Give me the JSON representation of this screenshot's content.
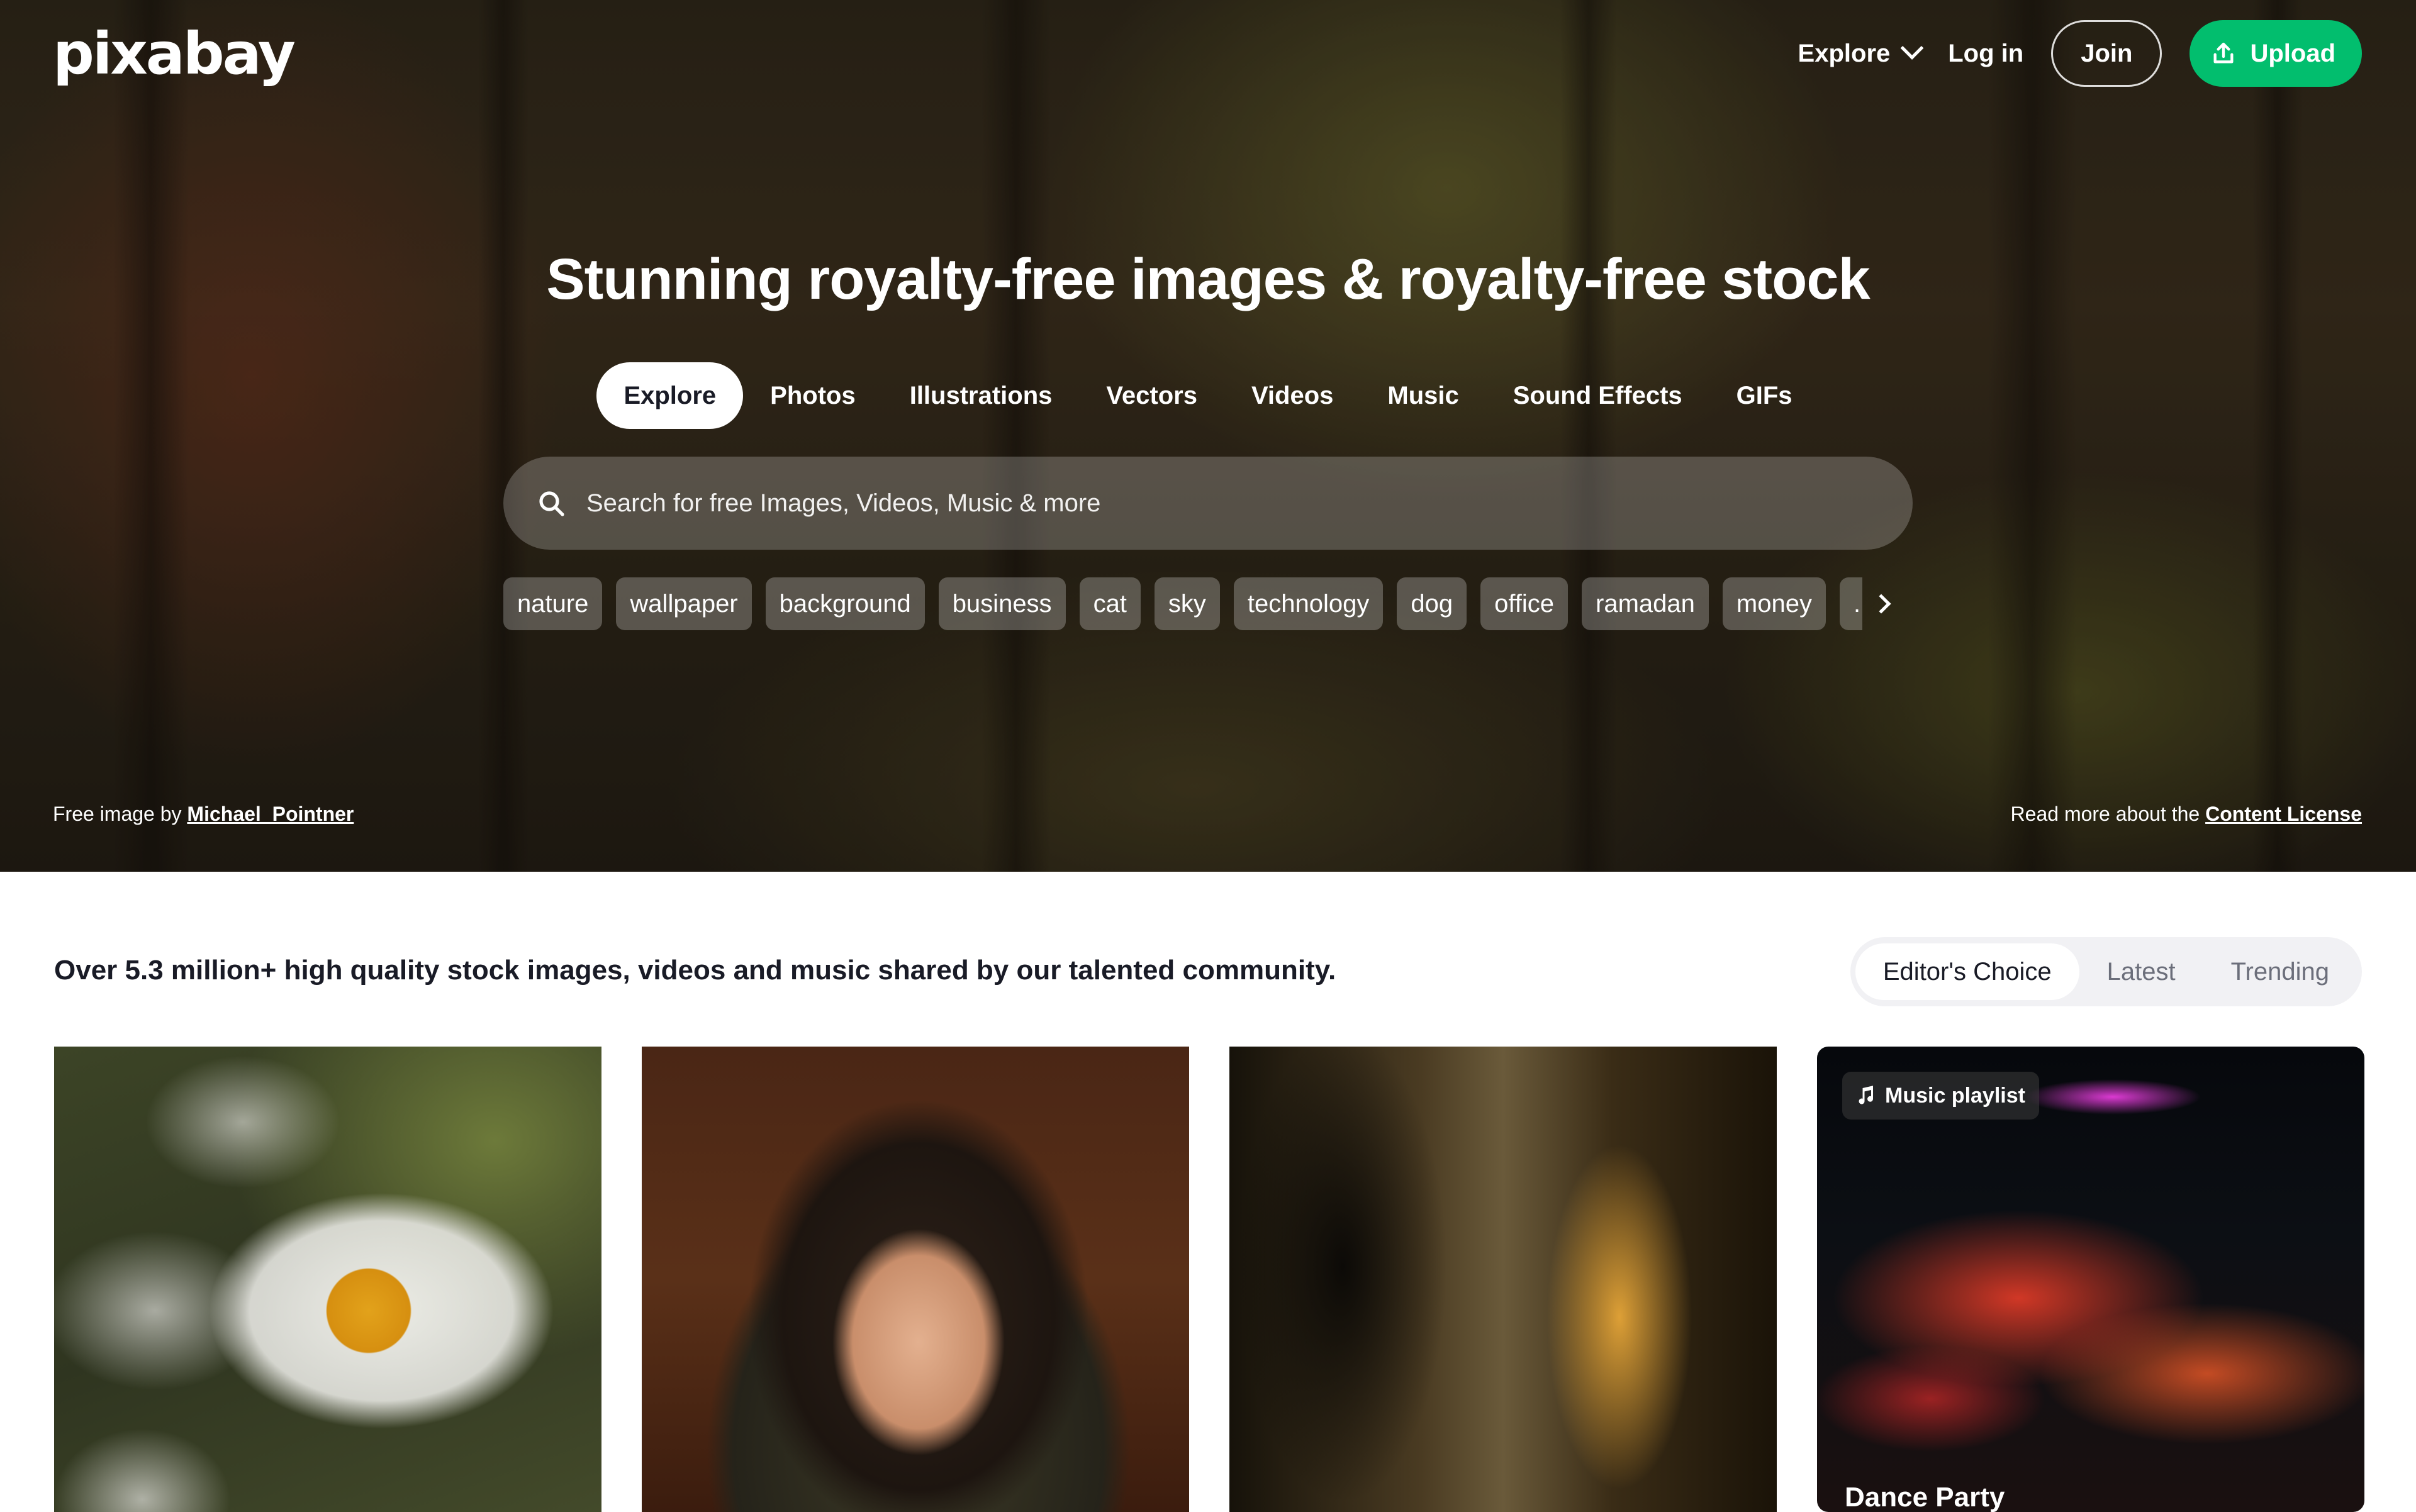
{
  "brand": {
    "logo": "pixabay",
    "accent": "#02be6e"
  },
  "nav": {
    "explore": "Explore",
    "login": "Log in",
    "join": "Join",
    "upload": "Upload"
  },
  "hero": {
    "headline": "Stunning royalty-free images & royalty-free stock",
    "tabs": [
      {
        "label": "Explore",
        "active": true
      },
      {
        "label": "Photos"
      },
      {
        "label": "Illustrations"
      },
      {
        "label": "Vectors"
      },
      {
        "label": "Videos"
      },
      {
        "label": "Music"
      },
      {
        "label": "Sound Effects"
      },
      {
        "label": "GIFs"
      }
    ],
    "search_placeholder": "Search for free Images, Videos, Music & more",
    "chips": [
      "nature",
      "wallpaper",
      "background",
      "business",
      "cat",
      "sky",
      "technology",
      "dog",
      "office",
      "ramadan",
      "money",
      "..."
    ],
    "credit_prefix": "Free image by",
    "credit_author": "Michael_Pointner",
    "license_prefix": "Read more about the",
    "license_link": "Content License"
  },
  "content": {
    "tagline": "Over 5.3 million+ high quality stock images, videos and music shared by our talented community.",
    "sort": [
      {
        "label": "Editor's Choice",
        "active": true
      },
      {
        "label": "Latest"
      },
      {
        "label": "Trending"
      }
    ],
    "cards": [
      {
        "kind": "image",
        "subject": "daisy flowers"
      },
      {
        "kind": "image",
        "subject": "woman with headscarf portrait"
      },
      {
        "kind": "image",
        "subject": "couple silhouettes at sunset"
      },
      {
        "kind": "music",
        "badge": "Music playlist",
        "title": "Dance Party"
      }
    ]
  }
}
